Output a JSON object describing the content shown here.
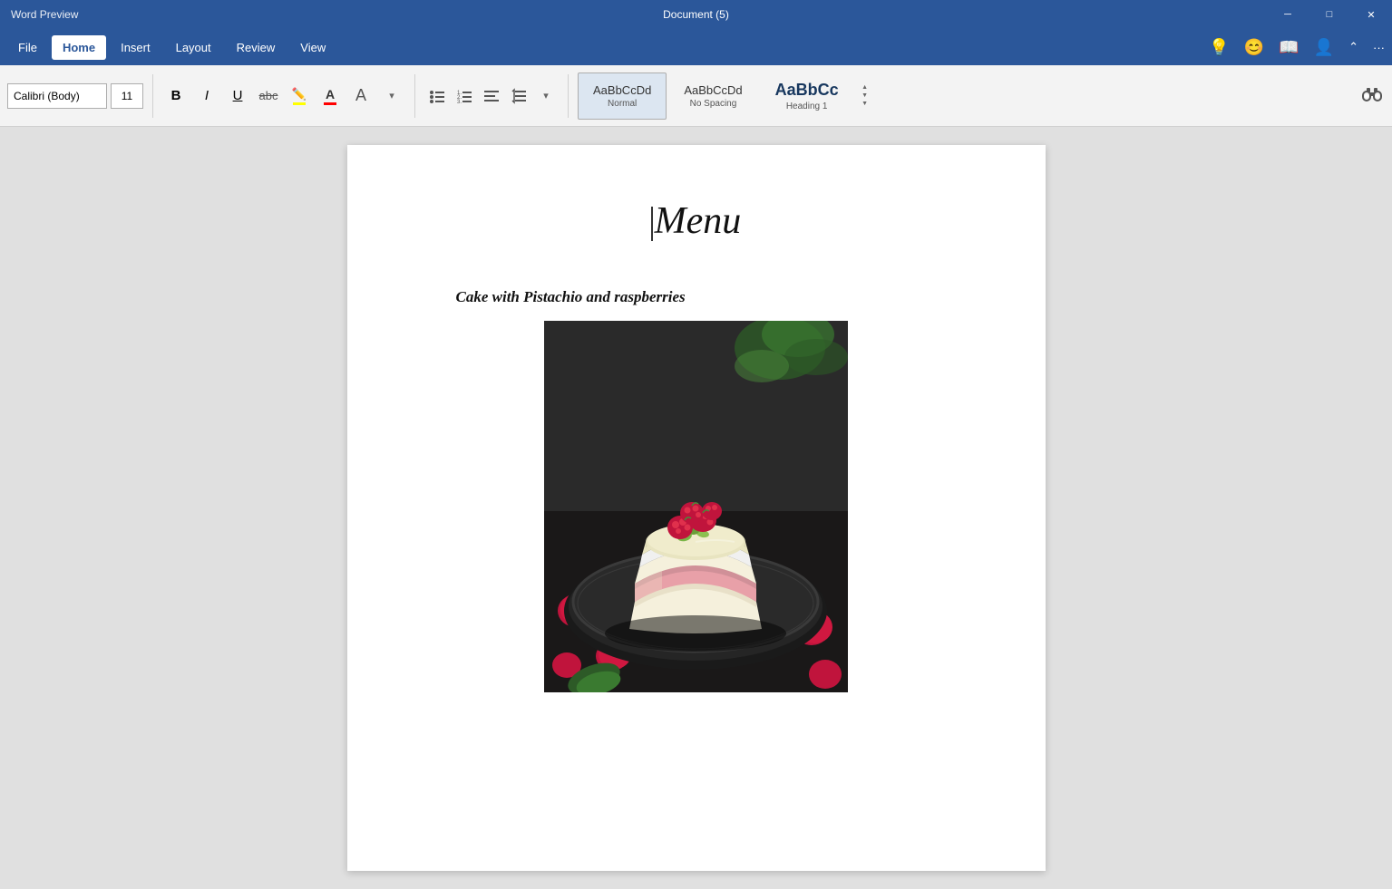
{
  "titlebar": {
    "title": "Document (5)",
    "minimize": "─",
    "maximize": "□",
    "close": "✕",
    "app_title": "Word Preview"
  },
  "menubar": {
    "items": [
      {
        "label": "File",
        "active": false
      },
      {
        "label": "Home",
        "active": true
      },
      {
        "label": "Insert",
        "active": false
      },
      {
        "label": "Layout",
        "active": false
      },
      {
        "label": "Review",
        "active": false
      },
      {
        "label": "View",
        "active": false
      }
    ],
    "icons": {
      "lightbulb": "💡",
      "smiley": "😊",
      "book": "📖",
      "person": "👤"
    }
  },
  "ribbon": {
    "font_name": "Calibri (Body)",
    "font_size": "11",
    "bold": "B",
    "italic": "I",
    "underline": "U",
    "strikethrough": "abc",
    "highlight": "ab",
    "font_color": "A",
    "more_arrow": "▾",
    "styles": {
      "normal": {
        "label": "Normal",
        "preview": "AaBbCcDd"
      },
      "no_spacing": {
        "label": "No Spacing",
        "preview": "AaBbCcDd"
      },
      "heading1": {
        "label": "Heading 1",
        "preview": "AaBbCc"
      }
    }
  },
  "document": {
    "title": "Menu",
    "subtitle": "Cake with Pistachio and raspberries",
    "cake_image_alt": "Cake with pistachio and raspberries on dark background"
  }
}
